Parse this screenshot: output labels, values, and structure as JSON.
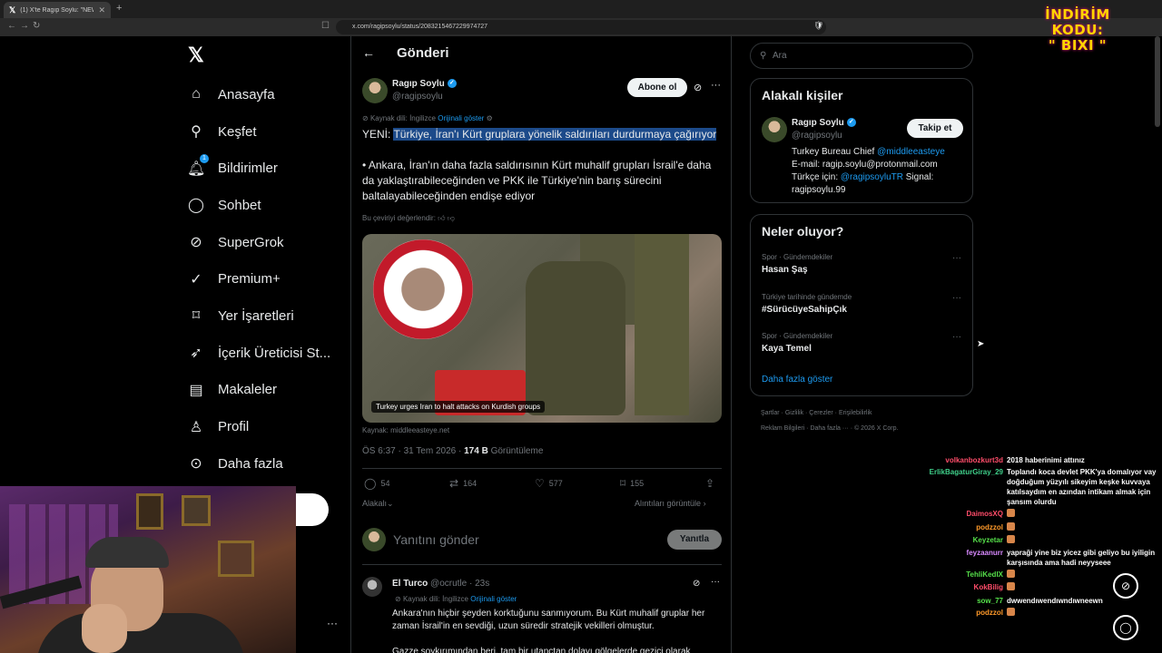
{
  "browser": {
    "tab_title": "(1) X'te Ragıp Soylu: \"NEW: Turk...",
    "url": "x.com/ragipsoylu/status/2083215467229974727"
  },
  "promo": {
    "line1": "İNDİRİM KODU:",
    "line2": "\" BIXI \""
  },
  "nav": {
    "items": [
      {
        "label": "Anasayfa",
        "icon": "home-icon"
      },
      {
        "label": "Keşfet",
        "icon": "search-icon"
      },
      {
        "label": "Bildirimler",
        "icon": "bell-icon",
        "badge": "1"
      },
      {
        "label": "Sohbet",
        "icon": "chat-icon"
      },
      {
        "label": "SuperGrok",
        "icon": "grok-icon"
      },
      {
        "label": "Premium+",
        "icon": "premium-icon"
      },
      {
        "label": "Yer İşaretleri",
        "icon": "bookmark-icon"
      },
      {
        "label": "İçerik Üreticisi St...",
        "icon": "rocket-icon"
      },
      {
        "label": "Makaleler",
        "icon": "article-icon"
      },
      {
        "label": "Profil",
        "icon": "profile-icon"
      },
      {
        "label": "Daha fazla",
        "icon": "more-circle-icon"
      }
    ]
  },
  "post": {
    "header_title": "Gönderi",
    "author_name": "Ragıp Soylu",
    "author_handle": "@ragipsoylu",
    "subscribe_label": "Abone ol",
    "source_lang": "Kaynak dili: İngilizce",
    "show_original": "Orijinali göster",
    "headline_prefix": "YENİ: ",
    "headline": "Türkiye, İran'ı Kürt gruplara yönelik saldırıları durdurmaya çağırıyor",
    "body": "• Ankara, İran'ın daha fazla saldırısının Kürt muhalif grupları İsrail'e daha da yaklaştırabileceğinden ve PKK ile Türkiye'nin barış sürecini baltalayabileceğinden endişe ediyor",
    "rate_translation": "Bu çeviriyi değerlendir:",
    "media_caption": "Turkey urges Iran to halt attacks on Kurdish groups",
    "media_source": "Kaynak: middleeasteye.net",
    "time": "ÖS 6:37 · 31 Tem 2026 · ",
    "views_count": "174 B",
    "views_label": " Görüntüleme",
    "replies": "54",
    "reposts": "164",
    "likes": "577",
    "bookmarks": "155",
    "related": "Alakalı",
    "view_quotes": "Alıntıları görüntüle",
    "reply_placeholder": "Yanıtını gönder",
    "reply_button": "Yanıtla"
  },
  "reply_tweet": {
    "name": "El Turco",
    "handle": "@ocrutle · 23s",
    "source_lang": "Kaynak dili: İngilizce",
    "show_original": "Orijinali göster",
    "text": "Ankara'nın hiçbir şeyden korktuğunu sanmıyorum. Bu Kürt muhalif gruplar her zaman İsrail'in en sevdiği, uzun süredir stratejik vekilleri olmuştur.",
    "text2": "Gazze soykırımından beri, tam bir utançtan dolayı gölgelerde gezici olarak"
  },
  "right": {
    "search_placeholder": "Ara",
    "related_title": "Alakalı kişiler",
    "person_name": "Ragıp Soylu",
    "person_handle": "@ragipsoylu",
    "follow_label": "Takip et",
    "bio_1": "Turkey Bureau Chief ",
    "bio_mention1": "@middleeasteye",
    "bio_2": "E-mail: ragip.soylu@protonmail.com",
    "bio_3": "Türkçe için: ",
    "bio_mention2": "@ragipsoyluTR",
    "bio_4": " Signal: ragipsoylu.99",
    "trends_title": "Neler oluyor?",
    "trends": [
      {
        "context": "Spor · Gündemdekiler",
        "title": "Hasan Şaş"
      },
      {
        "context": "Türkiye tarihinde gündemde",
        "title": "#SürücüyeSahipÇık"
      },
      {
        "context": "Spor · Gündemdekiler",
        "title": "Kaya Temel"
      }
    ],
    "show_more": "Daha fazla göster",
    "footer_1": "Şartlar  ·  Gizlilik  ·  Çerezler  ·  Erişilebilirlik",
    "footer_2": "Reklam Bilgileri  ·  Daha fazla ···  ·  © 2026 X Corp."
  },
  "chat": [
    {
      "user": "volkanbozkurt3d",
      "color": "#ff4d6a",
      "text": "2018 haberinimi attınız"
    },
    {
      "user": "ErlikBagaturGiray_29",
      "color": "#3fd08a",
      "text": "Toplandı koca devlet PKK'ya domalıyor vay doğduğum yüzyılı sikeyim keşke kuvvaya katılsaydım en azından intikam almak için şansım olurdu"
    },
    {
      "user": "DaimosXQ",
      "color": "#ff4d6a",
      "text": ""
    },
    {
      "user": "podzzol",
      "color": "#ff9a2a",
      "text": ""
    },
    {
      "user": "Keyzetar",
      "color": "#56e04a",
      "text": ""
    },
    {
      "user": "feyzaanurr",
      "color": "#d98aff",
      "text": "yapraği yine biz yicez gibi geliyo bu iyiligin karşısında ama hadi neyyseee"
    },
    {
      "user": "TehliKedIX",
      "color": "#56e04a",
      "text": ""
    },
    {
      "user": "KokBilig",
      "color": "#ff4d6a",
      "text": ""
    },
    {
      "user": "sow_77",
      "color": "#56e04a",
      "text": "dwwendıwendıwndıwneewn"
    },
    {
      "user": "podzzol",
      "color": "#ff9a2a",
      "text": ""
    }
  ]
}
